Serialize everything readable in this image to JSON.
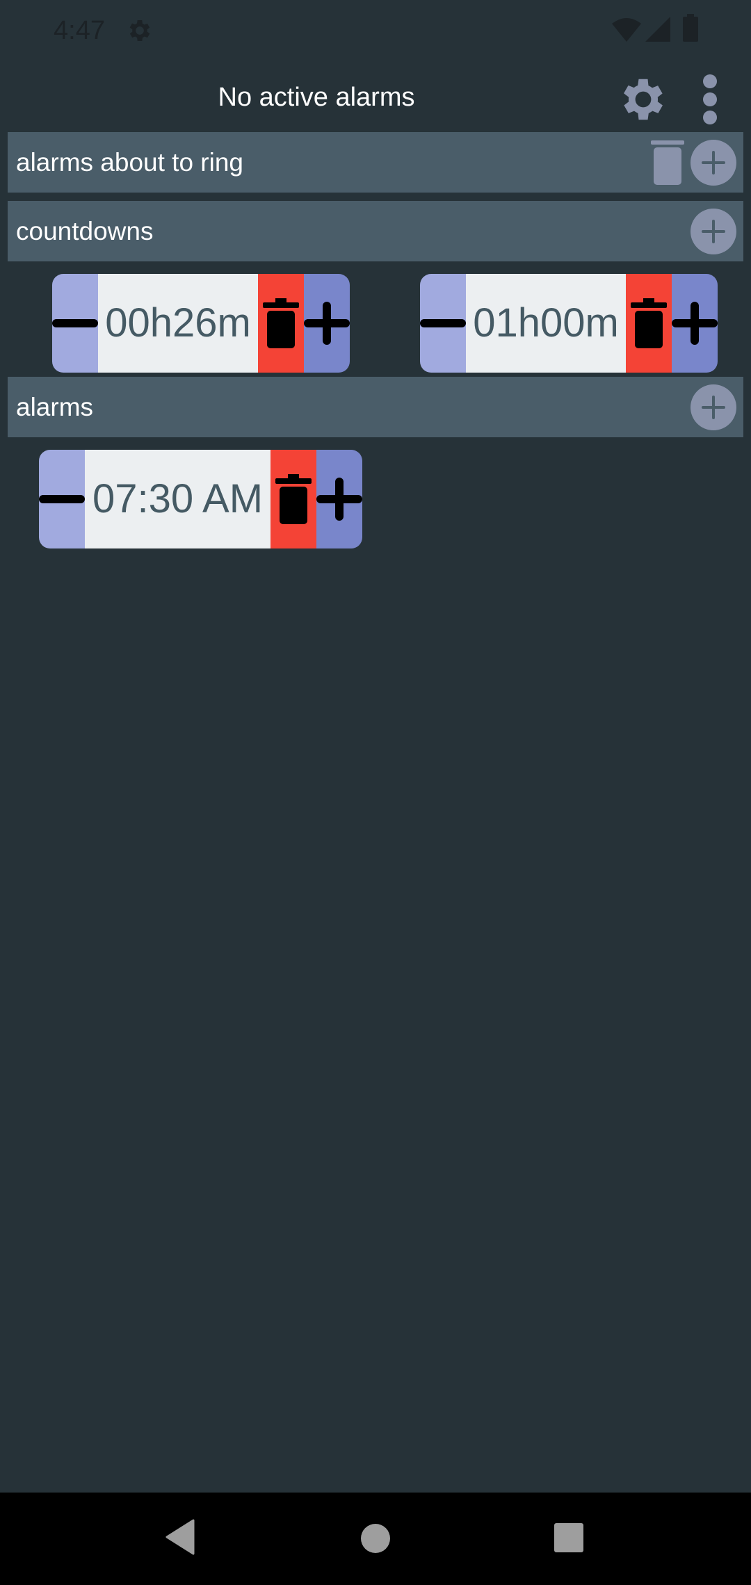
{
  "status_bar": {
    "time": "4:47",
    "icons": [
      "gear-icon",
      "wifi-icon",
      "signal-icon",
      "battery-icon"
    ]
  },
  "header": {
    "title": "No active alarms",
    "settings_icon": "gear-icon",
    "menu_icon": "more-vert-icon"
  },
  "sections": {
    "about_to_ring": {
      "label": "alarms about to ring"
    },
    "countdowns": {
      "label": "countdowns",
      "items": [
        {
          "value": "00h26m"
        },
        {
          "value": "01h00m"
        }
      ]
    },
    "alarms": {
      "label": "alarms",
      "items": [
        {
          "value": "07:30 AM"
        }
      ]
    }
  },
  "colors": {
    "background": "#263238",
    "section_bg": "#4a5d69",
    "minus_bg": "#a1aadf",
    "value_bg": "#eceff1",
    "value_text": "#455a64",
    "delete_bg": "#f44336",
    "plus_bg": "#7986cb",
    "accent_icon": "#8a93ab"
  },
  "nav_bar": {
    "buttons": [
      "back-icon",
      "home-icon",
      "recents-icon"
    ]
  }
}
